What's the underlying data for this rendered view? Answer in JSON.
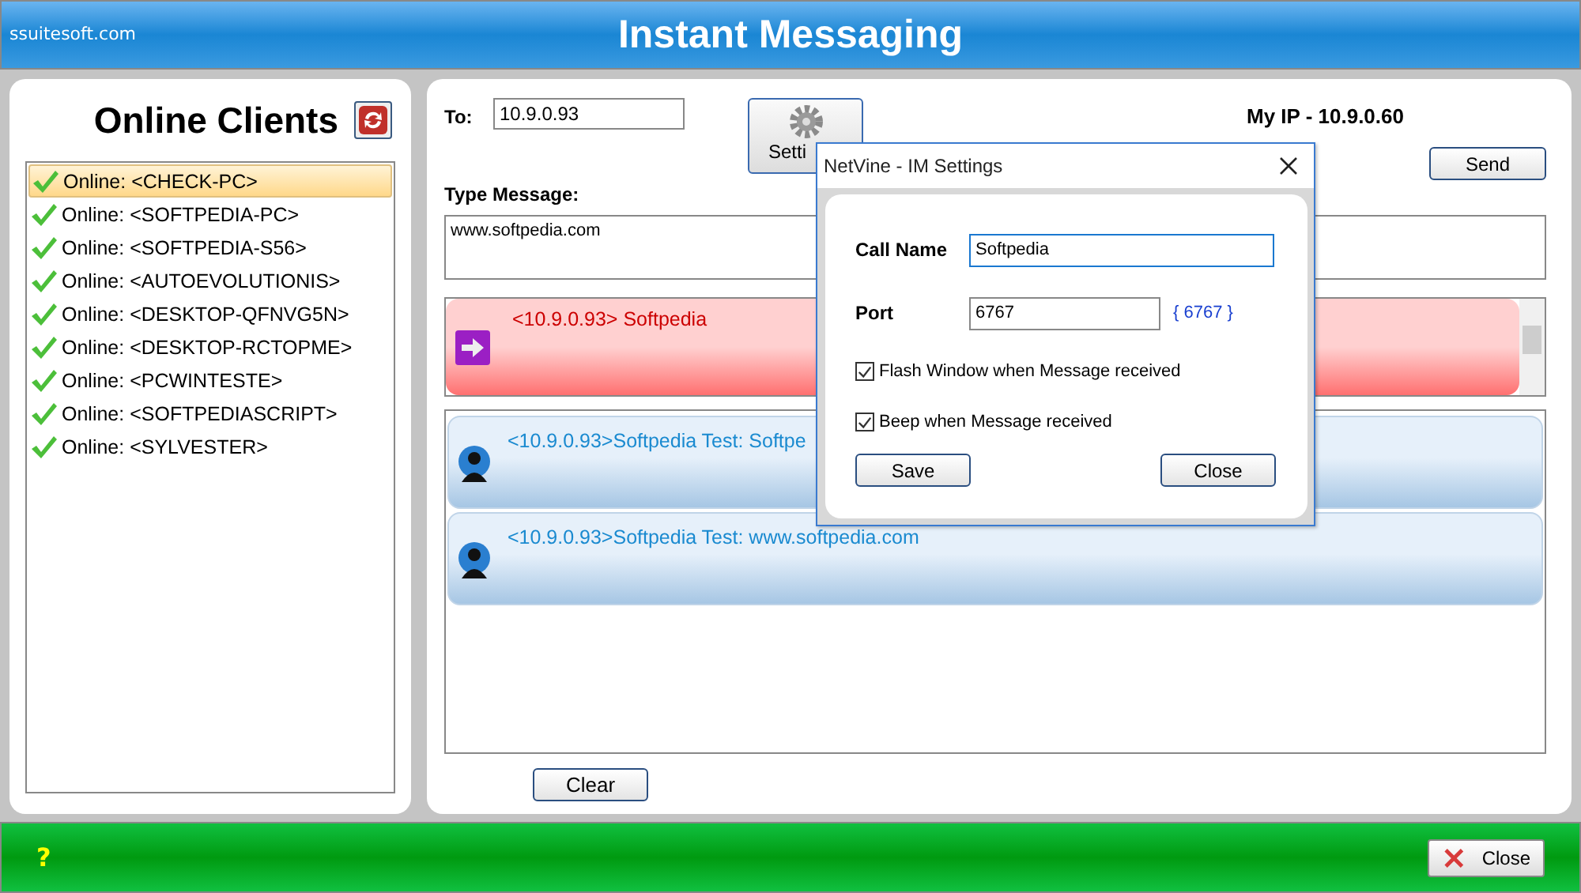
{
  "app": {
    "site": "ssuitesoft.com",
    "title": "Instant Messaging"
  },
  "clients": {
    "title": "Online Clients",
    "items": [
      {
        "label": "Online: <CHECK-PC>",
        "selected": true
      },
      {
        "label": "Online: <SOFTPEDIA-PC>",
        "selected": false
      },
      {
        "label": "Online: <SOFTPEDIA-S56>",
        "selected": false
      },
      {
        "label": "Online: <AUTOEVOLUTIONIS>",
        "selected": false
      },
      {
        "label": "Online: <DESKTOP-QFNVG5N>",
        "selected": false
      },
      {
        "label": "Online: <DESKTOP-RCTOPME>",
        "selected": false
      },
      {
        "label": "Online: <PCWINTESTE>",
        "selected": false
      },
      {
        "label": "Online: <SOFTPEDIASCRIPT>",
        "selected": false
      },
      {
        "label": "Online: <SYLVESTER>",
        "selected": false
      }
    ]
  },
  "compose": {
    "to_label": "To:",
    "to_value": "10.9.0.93",
    "settings_button": "Setti",
    "my_ip": "My IP - 10.9.0.60",
    "send_button": "Send",
    "message_label": "Type Message:",
    "message_value": "www.softpedia.com"
  },
  "incoming": {
    "text": "<10.9.0.93> Softpedia"
  },
  "history": [
    {
      "text": "<10.9.0.93>Softpedia Test: Softpe"
    },
    {
      "text": "<10.9.0.93>Softpedia Test: www.softpedia.com"
    }
  ],
  "clear_button": "Clear",
  "dialog": {
    "title": "NetVine - IM Settings",
    "call_name_label": "Call Name",
    "call_name_value": "Softpedia",
    "port_label": "Port",
    "port_value": "6767",
    "port_hint": "{ 6767 }",
    "options": [
      {
        "label": "Flash Window when Message received",
        "checked": true
      },
      {
        "label": "Beep when Message received",
        "checked": true
      }
    ],
    "save_button": "Save",
    "close_button": "Close"
  },
  "footer": {
    "help": "?",
    "close_button": "Close"
  }
}
